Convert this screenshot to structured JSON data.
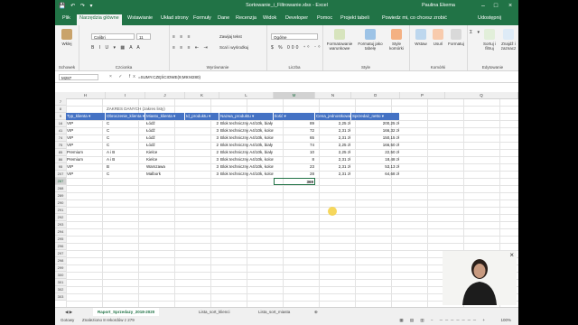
{
  "window": {
    "title": "Sortowanie_i_Filtrowanie.xlsx - Excel",
    "user": "Paulina Ekema"
  },
  "tabs": [
    "Plik",
    "Narzędzia główne",
    "Wstawianie",
    "Układ strony",
    "Formuły",
    "Dane",
    "Recenzja",
    "Widok",
    "Developer",
    "Pomoc",
    "Projekt tabeli",
    "Powiedz mi, co chcesz zrobić",
    "Udostępnij"
  ],
  "ribbon": {
    "schowek": {
      "paste": "Wklej",
      "label": "Schowek"
    },
    "czcionka": {
      "font": "Calibri",
      "size": "11",
      "label": "Czcionka"
    },
    "wyrownanie": {
      "wrap": "Zawijaj tekst",
      "merge": "Scal i wyśrodkuj",
      "label": "Wyrównanie"
    },
    "liczba": {
      "format": "Ogólne",
      "label": "Liczba"
    },
    "style": {
      "cond": "Formatowanie warunkowe",
      "table": "Formatuj jako tabelę",
      "cellstyles": "Style komórki",
      "label": "Style"
    },
    "komorki": {
      "insert": "Wstaw",
      "delete": "Usuń",
      "format": "Formatuj",
      "label": "Komórki"
    },
    "edycja": {
      "sort": "Sortuj i filtruj",
      "find": "Znajdź i zaznacz",
      "label": "Edytowanie"
    }
  },
  "formula_bar": {
    "cell": "M287",
    "formula": "=SUMY.CZĘŚCIOWE(9;M9:M280)"
  },
  "grid": {
    "columns": [
      "H",
      "I",
      "J",
      "K",
      "L",
      "M",
      "N",
      "O",
      "P",
      "Q"
    ],
    "selected_col": "M",
    "zakres_label": "ZAKRES DANYCH (zakres listy)",
    "headers": [
      "Typ_klienta",
      "Obroczenie_klienta",
      "Miasto_klienta",
      "Id_produktu",
      "Nazwa_produktu",
      "Ilość",
      "Cena_jednostkowa_netto",
      "Sprzedaż_netto"
    ],
    "rows": [
      {
        "num": "16",
        "cells": [
          "VIP",
          "C",
          "Łódź",
          "2",
          "Blok techniczny A4/10k, biały",
          "89",
          "2,25 zł",
          "200,25 zł"
        ]
      },
      {
        "num": "41",
        "cells": [
          "VIP",
          "C",
          "Łódź",
          "3",
          "Blok techniczny A4/10k, kolorowy",
          "72",
          "2,31 zł",
          "166,32 zł"
        ]
      },
      {
        "num": "74",
        "cells": [
          "VIP",
          "C",
          "Łódź",
          "3",
          "Blok techniczny A4/10k, kolorowy",
          "65",
          "2,31 zł",
          "150,15 zł"
        ]
      },
      {
        "num": "75",
        "cells": [
          "VIP",
          "C",
          "Łódź",
          "2",
          "Blok techniczny A4/10k, biały",
          "74",
          "2,25 zł",
          "166,50 zł"
        ]
      },
      {
        "num": "85",
        "cells": [
          "Premium",
          "A i B",
          "Kielce",
          "2",
          "Blok techniczny A4/10k, biały",
          "10",
          "2,25 zł",
          "22,50 zł"
        ]
      },
      {
        "num": "86",
        "cells": [
          "Premium",
          "A i B",
          "Kielce",
          "3",
          "Blok techniczny A4/10k, kolorowy",
          "8",
          "2,31 zł",
          "18,48 zł"
        ]
      },
      {
        "num": "95",
        "cells": [
          "VIP",
          "B",
          "Warszawa",
          "3",
          "Blok techniczny A4/10k, kolorowy",
          "23",
          "2,31 zł",
          "53,13 zł"
        ]
      },
      {
        "num": "207",
        "cells": [
          "VIP",
          "C",
          "Malbork",
          "3",
          "Blok techniczny A4/10k, kolorowy",
          "28",
          "2,31 zł",
          "64,68 zł"
        ]
      }
    ],
    "total_row": {
      "num": "287",
      "value": "369"
    },
    "empty_rows": [
      "288",
      "289",
      "290",
      "291",
      "292",
      "293",
      "294",
      "295",
      "296",
      "297",
      "298",
      "299",
      "300",
      "301",
      "302",
      "303",
      "304",
      "305",
      "306",
      "307",
      "308",
      "309",
      "310"
    ]
  },
  "sheet_tabs": [
    "Raport_Sprzedazy_2018-2020",
    "Lista_sort_klienci",
    "Lista_sort_miasta"
  ],
  "status": {
    "left": "Gotowy",
    "records": "Znaleziono 8 rekordów z 279",
    "zoom": "100%"
  },
  "colors": {
    "excel_green": "#217346",
    "table_header": "#4472c4"
  }
}
